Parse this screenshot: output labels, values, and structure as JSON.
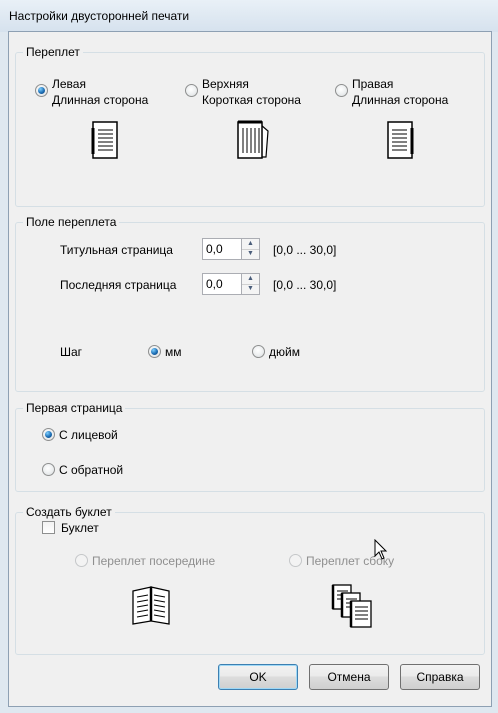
{
  "window": {
    "title": "Настройки двусторонней печати"
  },
  "binding": {
    "legend": "Переплет",
    "options": [
      {
        "line1": "Левая",
        "line2": "Длинная сторона",
        "checked": true,
        "icon": "portrait-page-left-binding-icon"
      },
      {
        "line1": "Верхняя",
        "line2": "Короткая сторона",
        "checked": false,
        "icon": "landscape-page-top-binding-icon"
      },
      {
        "line1": "Правая",
        "line2": "Длинная сторона",
        "checked": false,
        "icon": "portrait-page-right-binding-icon"
      }
    ]
  },
  "margin": {
    "legend": "Поле переплета",
    "title_page_label": "Титульная страница",
    "title_page_value": "0,0",
    "title_page_range": "[0,0 ... 30,0]",
    "last_page_label": "Последняя страница",
    "last_page_value": "0,0",
    "last_page_range": "[0,0 ... 30,0]",
    "step_label": "Шаг",
    "unit_mm": "мм",
    "unit_inch": "дюйм",
    "selected_unit": "мм"
  },
  "first_page": {
    "legend": "Первая страница",
    "front": "С лицевой",
    "back": "С обратной",
    "selected": "С лицевой"
  },
  "booklet": {
    "legend": "Создать буклет",
    "checkbox_label": "Буклет",
    "checked": false,
    "center_label": "Переплет посередине",
    "side_label": "Переплет сбоку",
    "center_icon": "booklet-center-binding-icon",
    "side_icon": "booklet-side-binding-icon"
  },
  "buttons": {
    "ok": "OK",
    "cancel": "Отмена",
    "help": "Справка"
  },
  "colors": {
    "accent": "#1d6eb5",
    "disabled_text": "#8f8f8f",
    "group_border": "#d5dfe5"
  }
}
